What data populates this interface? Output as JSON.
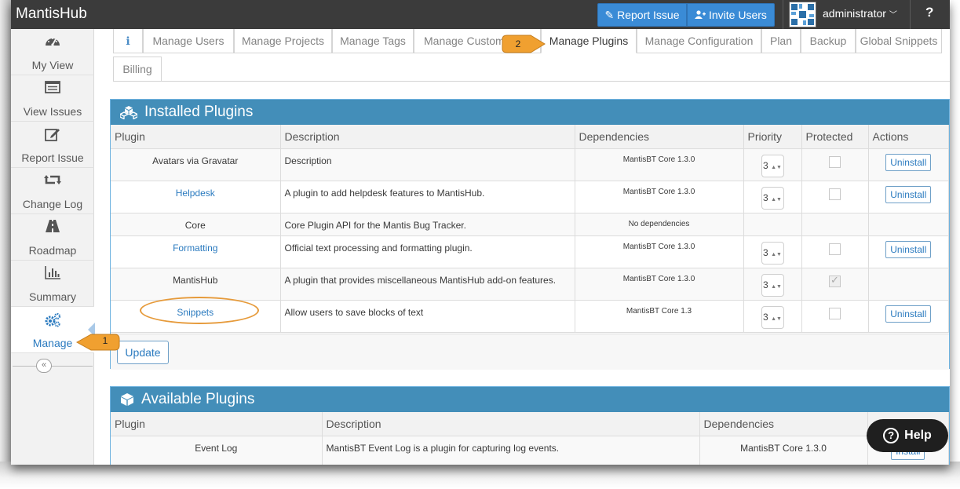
{
  "app": {
    "brand": "MantisHub"
  },
  "navbar": {
    "report_issue": "Report Issue",
    "invite_users": "Invite Users",
    "username": "administrator",
    "help_label": "?"
  },
  "sidebar": {
    "items": [
      {
        "label": "My View",
        "icon": "dashboard-icon"
      },
      {
        "label": "View Issues",
        "icon": "list-icon"
      },
      {
        "label": "Report Issue",
        "icon": "edit-icon"
      },
      {
        "label": "Change Log",
        "icon": "retweet-icon"
      },
      {
        "label": "Roadmap",
        "icon": "road-icon"
      },
      {
        "label": "Summary",
        "icon": "bar-chart-icon"
      },
      {
        "label": "Manage",
        "icon": "gears-icon"
      }
    ],
    "active": "Manage",
    "collapse_label": "«"
  },
  "tabs": {
    "items": [
      {
        "label": "ℹ"
      },
      {
        "label": "Manage Users"
      },
      {
        "label": "Manage Projects"
      },
      {
        "label": "Manage Tags"
      },
      {
        "label": "Manage Custom Fields"
      },
      {
        "label": "Manage Plugins"
      },
      {
        "label": "Manage Configuration"
      },
      {
        "label": "Plan"
      },
      {
        "label": "Backup"
      },
      {
        "label": "Global Snippets"
      },
      {
        "label": "Billing"
      }
    ],
    "active": "Manage Plugins"
  },
  "installed": {
    "title": "Installed Plugins",
    "columns": [
      "Plugin",
      "Description",
      "Dependencies",
      "Priority",
      "Protected",
      "Actions"
    ],
    "rows": [
      {
        "plugin": "Avatars via Gravatar",
        "description": "Description",
        "dependencies": "MantisBT Core 1.3.0",
        "priority": "3",
        "protected": false,
        "action": "Uninstall",
        "is_link": false
      },
      {
        "plugin": "Helpdesk",
        "description": "A plugin to add helpdesk features to MantisHub.",
        "dependencies": "MantisBT Core 1.3.0",
        "priority": "3",
        "protected": false,
        "action": "Uninstall",
        "is_link": true
      },
      {
        "plugin": "Core",
        "description": "Core Plugin API for the Mantis Bug Tracker.",
        "dependencies": "No dependencies",
        "priority": "",
        "protected": null,
        "action": "",
        "is_link": false
      },
      {
        "plugin": "Formatting",
        "description": "Official text processing and formatting plugin.",
        "dependencies": "MantisBT Core 1.3.0",
        "priority": "3",
        "protected": false,
        "action": "Uninstall",
        "is_link": true
      },
      {
        "plugin": "MantisHub",
        "description": "A plugin that provides miscellaneous MantisHub add-on features.",
        "dependencies": "MantisBT Core 1.3.0",
        "priority": "3",
        "protected": true,
        "action": "",
        "is_link": false
      },
      {
        "plugin": "Snippets",
        "description": "Allow users to save blocks of text",
        "dependencies": "MantisBT Core 1.3",
        "priority": "3",
        "protected": false,
        "action": "Uninstall",
        "is_link": true
      }
    ],
    "update_label": "Update"
  },
  "available": {
    "title": "Available Plugins",
    "columns": [
      "Plugin",
      "Description",
      "Dependencies",
      ""
    ],
    "rows": [
      {
        "plugin": "Event Log",
        "description": "MantisBT Event Log is a plugin for capturing log events.",
        "dependencies": "MantisBT Core 1.3.0",
        "action": "Install"
      }
    ]
  },
  "help_widget": {
    "label": "Help"
  },
  "callouts": [
    {
      "number": "1"
    },
    {
      "number": "2"
    }
  ],
  "colors": {
    "navbar": "#3b3b3b",
    "primary_button": "#3a8bd6",
    "widget_header": "#438eb9",
    "link": "#2a7abf",
    "callout": "#f0a030"
  }
}
